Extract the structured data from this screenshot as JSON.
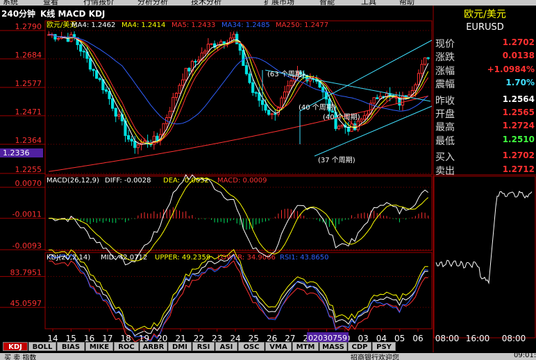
{
  "menu": [
    "系统",
    "查看",
    "行情报价",
    "分析分析",
    "技术分析",
    "扩展市场",
    "智能",
    "工具",
    "帮助"
  ],
  "header": {
    "period": "240分钟",
    "indicators": "K线 MACD KDJ"
  },
  "price_panel": {
    "legend": [
      {
        "text": "欧元/美元",
        "color": "#ffff00"
      },
      {
        "text": "MA4: 1.2462",
        "color": "#ffffff"
      },
      {
        "text": "MA4: 1.2414",
        "color": "#ffff00"
      },
      {
        "text": "MA5: 1.2433",
        "color": "#ff3030"
      },
      {
        "text": "MA34: 1.2485",
        "color": "#3060ff"
      },
      {
        "text": "MA250: 1.2477",
        "color": "#ff3030"
      }
    ],
    "yticks": [
      "1.2790",
      "1.2684",
      "1.2577",
      "1.2471",
      "1.2364",
      "1.2255"
    ],
    "ylim": [
      1.2255,
      1.279
    ],
    "cursor_price": "1.2336",
    "annotations": [
      "(63 个周期)",
      "(40 个周期)",
      "(40 个周期)",
      "(37 个周期)"
    ]
  },
  "macd_panel": {
    "legend": [
      {
        "text": "MACD(26,12,9)",
        "color": "#ffffff"
      },
      {
        "text": "DIFF: -0.0028",
        "color": "#ffffff"
      },
      {
        "text": "DEA: -0.0032",
        "color": "#ffff00"
      },
      {
        "text": "MACD: 0.0009",
        "color": "#ff3030"
      }
    ],
    "yticks": [
      "0.0070",
      "-0.0011",
      "-0.0093"
    ]
  },
  "kdj_panel": {
    "legend": [
      {
        "text": "KDJ(20,2,14)",
        "color": "#ffffff"
      },
      {
        "text": "MID: 42.0712",
        "color": "#ffffff"
      },
      {
        "text": "UPPER: 49.2359",
        "color": "#ffff00"
      },
      {
        "text": "LOWER: 34.9066",
        "color": "#ff3030"
      },
      {
        "text": "RSI1: 43.8650",
        "color": "#3060ff"
      }
    ],
    "yticks": [
      "83.7951",
      "45.0597"
    ]
  },
  "xaxis": {
    "labels": [
      "14",
      "15",
      "16",
      "17",
      "18",
      "19",
      "20",
      "21",
      "22",
      "23",
      "24",
      "25",
      "26",
      "27",
      "28",
      "29",
      "30",
      "03",
      "04",
      "05",
      "06"
    ],
    "cursor_date": "02030759"
  },
  "quote": {
    "title": "欧元/美元",
    "code": "EURUSD",
    "rows": [
      {
        "label": "现价",
        "value": "1.2702",
        "color": "#ff3030"
      },
      {
        "label": "涨跌",
        "value": "0.0138",
        "color": "#ff3030"
      },
      {
        "label": "涨幅",
        "value": "+1.0984%",
        "color": "#ff3030"
      },
      {
        "label": "震幅",
        "value": "1.70%",
        "color": "#40e0ff"
      },
      {
        "label": "昨收",
        "value": "1.2564",
        "color": "#ffffff"
      },
      {
        "label": "开盘",
        "value": "1.2565",
        "color": "#ff3030"
      },
      {
        "label": "最高",
        "value": "1.2724",
        "color": "#ff3030"
      },
      {
        "label": "最低",
        "value": "1.2510",
        "color": "#40ff40"
      },
      {
        "label": "买入",
        "value": "1.2702",
        "color": "#ff3030"
      },
      {
        "label": "卖出",
        "value": "1.2712",
        "color": "#ff3030"
      }
    ]
  },
  "mini_chart": {
    "x_labels": [
      "08:00",
      "16:00",
      "08:00"
    ]
  },
  "tabs": [
    "KDJ",
    "BOLL",
    "BIAS",
    "MIKE",
    "ROC",
    "ARBR",
    "DMI",
    "RSI",
    "ASI",
    "OSC",
    "VMA",
    "MTM",
    "MASS",
    "CDP",
    "PSY"
  ],
  "status": {
    "left": "买 卖 指数",
    "center": "招商银行欢迎您",
    "time": "09:01:49"
  },
  "colors": {
    "up": "#ff3030",
    "down": "#00e0e0",
    "grid": "#800000",
    "axis": "#a00000"
  }
}
